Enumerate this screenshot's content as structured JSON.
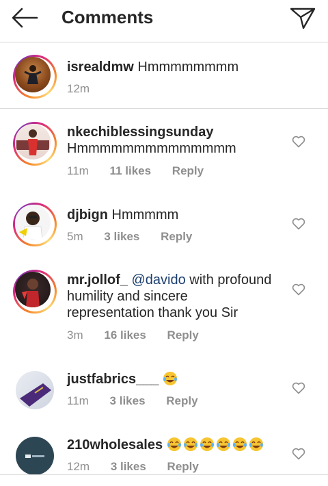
{
  "header": {
    "title": "Comments",
    "back_icon": "arrow-left-icon",
    "send_icon": "paper-plane-icon"
  },
  "comments": [
    {
      "username": "isrealdmw",
      "text": "Hmmmmmmmm",
      "time": "12m",
      "likes": "",
      "reply": ""
    },
    {
      "username": "nkechiblessingsunday",
      "text": "Hmmmmmmmmmmmmmm",
      "time": "11m",
      "likes": "11 likes",
      "reply": "Reply"
    },
    {
      "username": "djbign",
      "text": "Hmmmmm",
      "time": "5m",
      "likes": "3 likes",
      "reply": "Reply"
    },
    {
      "username": "mr.jollof_",
      "mention": "@davido",
      "text": "with profound humility and sincere representation thank you Sir",
      "time": "3m",
      "likes": "16 likes",
      "reply": "Reply"
    },
    {
      "username": "justfabrics___",
      "text": "",
      "emoji": "tears-of-joy-emoji",
      "time": "11m",
      "likes": "3 likes",
      "reply": "Reply"
    },
    {
      "username": "210wholesales",
      "text": "",
      "emoji": "tears-of-joy-emoji x6",
      "time": "12m",
      "likes": "3 likes",
      "reply": "Reply"
    }
  ],
  "colors": {
    "mention": "#1b3e6e",
    "meta": "#8e8e8e",
    "text": "#262626"
  }
}
